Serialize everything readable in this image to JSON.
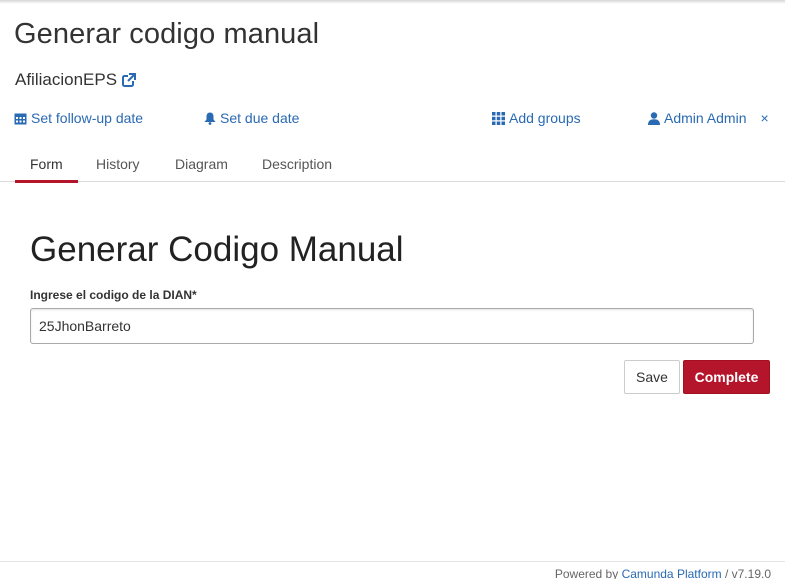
{
  "task": {
    "title": "Generar codigo manual",
    "process_name": "AfiliacionEPS"
  },
  "actions": {
    "follow_up": "Set follow-up date",
    "due_date": "Set due date",
    "add_groups": "Add groups",
    "assignee": "Admin Admin",
    "remove_assignee": "×"
  },
  "tabs": [
    {
      "label": "Form",
      "active": true
    },
    {
      "label": "History",
      "active": false
    },
    {
      "label": "Diagram",
      "active": false
    },
    {
      "label": "Description",
      "active": false
    }
  ],
  "form": {
    "title": "Generar Codigo Manual",
    "field_label": "Ingrese el codigo de la DIAN*",
    "field_value": "25JhonBarreto",
    "save_label": "Save",
    "complete_label": "Complete"
  },
  "footer": {
    "powered_by": "Powered by",
    "brand": "Camunda Platform",
    "version": "/ v7.19.0"
  },
  "colors": {
    "accent": "#b5152b",
    "link": "#2a6ab3"
  }
}
